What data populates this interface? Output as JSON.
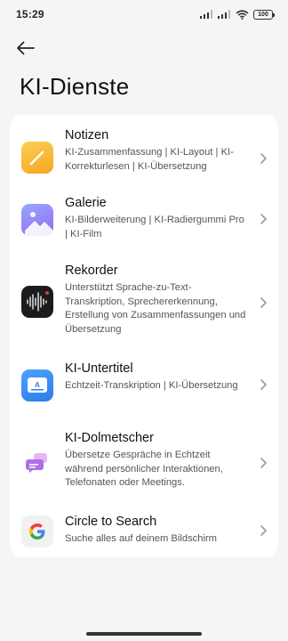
{
  "status_bar": {
    "time": "15:29",
    "battery": "100"
  },
  "header": {
    "title": "KI-Dienste"
  },
  "services": [
    {
      "title": "Notizen",
      "description": "KI-Zusammenfassung | KI-Layout | KI-Korrekturlesen | KI-Übersetzung",
      "icon": "notes-icon"
    },
    {
      "title": "Galerie",
      "description": "KI-Bilderweiterung | KI-Radiergummi Pro | KI-Film",
      "icon": "gallery-icon"
    },
    {
      "title": "Rekorder",
      "description": "Unterstützt Sprache-zu-Text-Transkription, Sprechererkennung, Erstellung von Zusammenfassungen und Übersetzung",
      "icon": "recorder-icon"
    },
    {
      "title": "KI-Untertitel",
      "description": "Echtzeit-Transkription | KI-Übersetzung",
      "icon": "subtitles-icon"
    },
    {
      "title": "KI-Dolmetscher",
      "description": "Übersetze Gespräche in Echtzeit während persönlicher Interaktionen, Telefonaten oder Meetings.",
      "icon": "interpreter-icon"
    },
    {
      "title": "Circle to Search",
      "description": "Suche alles auf deinem Bildschirm",
      "icon": "google-icon"
    }
  ],
  "colors": {
    "background": "#f5f5f5",
    "card": "#ffffff",
    "notes": "#f7b733",
    "gallery": "#7a7ff0",
    "recorder": "#1c1c1c",
    "subtitles": "#3d8cf0",
    "interpreter": "#c36ee8"
  }
}
